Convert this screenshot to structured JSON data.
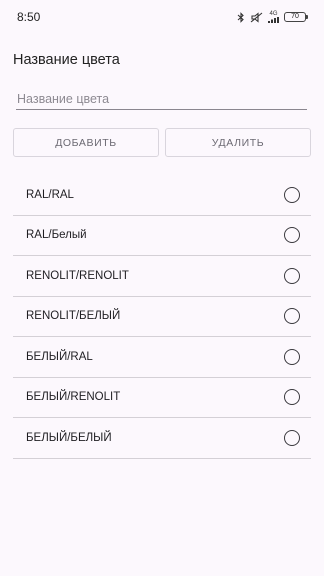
{
  "status_bar": {
    "time": "8:50",
    "network_label": "4G",
    "battery": "70",
    "icons": [
      "bluetooth-icon",
      "mute-icon",
      "signal-icon",
      "battery-icon"
    ]
  },
  "page": {
    "title": "Название цвета"
  },
  "input": {
    "placeholder": "Название цвета",
    "value": ""
  },
  "buttons": {
    "add": "ДОБАВИТЬ",
    "delete": "УДАЛИТЬ"
  },
  "colors": [
    {
      "label": "RAL/RAL",
      "selected": false
    },
    {
      "label": "RAL/Белый",
      "selected": false
    },
    {
      "label": "RENOLIT/RENOLIT",
      "selected": false
    },
    {
      "label": "RENOLIT/БЕЛЫЙ",
      "selected": false
    },
    {
      "label": "БЕЛЫЙ/RAL",
      "selected": false
    },
    {
      "label": "БЕЛЫЙ/RENOLIT",
      "selected": false
    },
    {
      "label": "БЕЛЫЙ/БЕЛЫЙ",
      "selected": false
    }
  ]
}
